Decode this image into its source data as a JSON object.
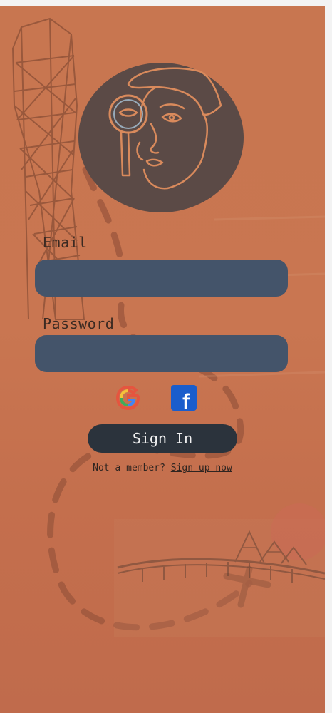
{
  "form": {
    "email_label": "Email",
    "email_value": "",
    "password_label": "Password",
    "password_value": ""
  },
  "social": {
    "google_icon": "google-icon",
    "facebook_icon": "facebook-icon",
    "facebook_letter": "f"
  },
  "actions": {
    "signin_label": "Sign In",
    "member_text": "Not a member?",
    "signup_link": "Sign up now"
  },
  "colors": {
    "background": "#c87650",
    "field": "#44546a",
    "button": "#2b333c",
    "logo_circle": "#5b4a46",
    "logo_line": "#d98a5c",
    "facebook_blue": "#1877f2"
  }
}
